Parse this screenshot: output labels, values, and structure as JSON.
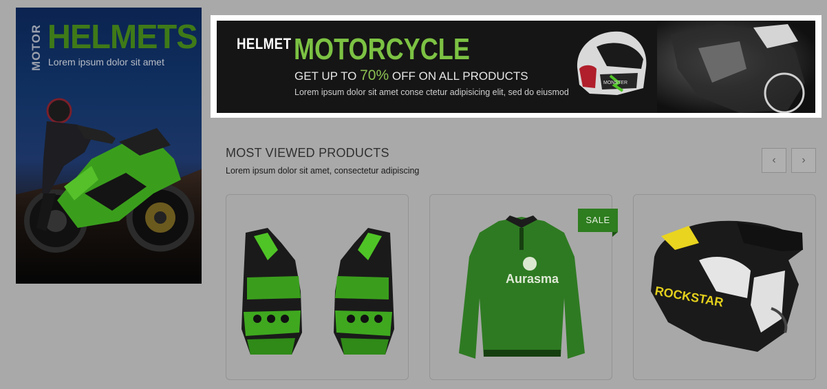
{
  "side_banner": {
    "kicker": "MOTOR",
    "title": "HELMETS",
    "subtitle": "Lorem ipsum dolor sit amet"
  },
  "top_banner": {
    "label": "HELMET",
    "title": "MOTORCYCLE",
    "offer_prefix": "GET UP TO",
    "offer_percent": "70%",
    "offer_suffix": "OFF ON ALL PRODUCTS",
    "description": "Lorem ipsum dolor sit amet conse ctetur adipisicing elit, sed do eiusmod"
  },
  "section": {
    "title": "MOST VIEWED PRODUCTS",
    "subtitle": "Lorem ipsum dolor sit amet, consectetur adipiscing"
  },
  "carousel": {
    "prev_icon": "‹",
    "next_icon": "›"
  },
  "products": [
    {
      "image": "gloves-icon"
    },
    {
      "image": "jersey-icon",
      "badge": "SALE"
    },
    {
      "image": "motocross-helmet-icon"
    }
  ],
  "colors": {
    "accent_green": "#7cc243",
    "sale_green": "#2e7d1f",
    "page_overlay": "#a9a9a9"
  }
}
